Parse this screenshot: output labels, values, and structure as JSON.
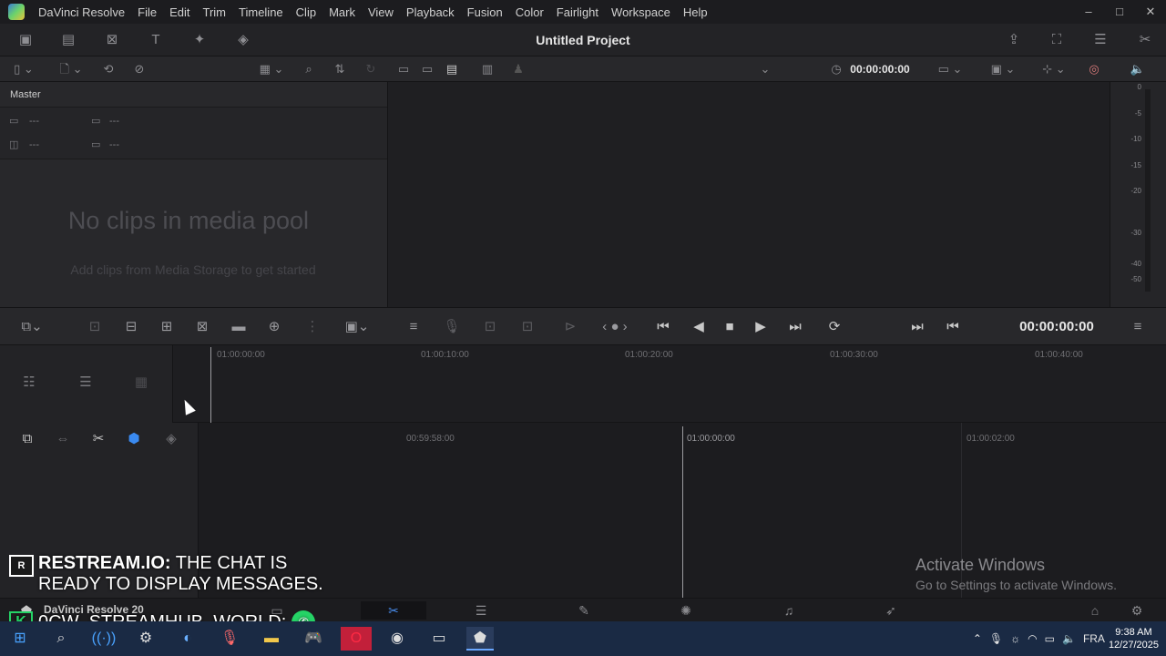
{
  "app": {
    "name": "DaVinci Resolve"
  },
  "menu": [
    "DaVinci Resolve",
    "File",
    "Edit",
    "Trim",
    "Timeline",
    "Clip",
    "Mark",
    "View",
    "Playback",
    "Fusion",
    "Color",
    "Fairlight",
    "Workspace",
    "Help"
  ],
  "window_controls": [
    "–",
    "□",
    "✕"
  ],
  "toolbar": {
    "project_title": "Untitled Project"
  },
  "viewer": {
    "timecode": "00:00:00:00"
  },
  "media_pool": {
    "bin": "Master",
    "meta": [
      "---",
      "---",
      "---",
      "---"
    ],
    "empty_title": "No clips in media pool",
    "empty_hint": "Add clips from Media Storage to get started"
  },
  "audio_meter": {
    "ticks": [
      "0",
      "-5",
      "-10",
      "-15",
      "-20",
      "-30",
      "-40",
      "-50"
    ]
  },
  "transport": {
    "timecode": "00:00:00:00"
  },
  "timeline_upper": {
    "ruler": [
      "01:00:00:00",
      "01:00:10:00",
      "01:00:20:00",
      "01:00:30:00",
      "01:00:40:00"
    ]
  },
  "timeline_lower": {
    "ruler": [
      "00:59:58:00",
      "01:00:00:00",
      "01:00:02:00"
    ]
  },
  "activate_windows": {
    "title": "Activate Windows",
    "subtitle": "Go to Settings to activate Windows."
  },
  "overlay": {
    "restream_logo": "R",
    "restream_brand": "RESTREAM.IO:",
    "restream_msg_line1": "THE CHAT IS",
    "restream_msg_line2": "READY TO DISPLAY MESSAGES.",
    "stream_user": "0CW_STREAMHUB_WORLD:",
    "stream_badge": "K"
  },
  "page_bar": {
    "label": "DaVinci Resolve 20"
  },
  "taskbar": {
    "tray_lang": "FRA",
    "clock_time": "9:38 AM",
    "clock_date": "12/27/2025"
  }
}
